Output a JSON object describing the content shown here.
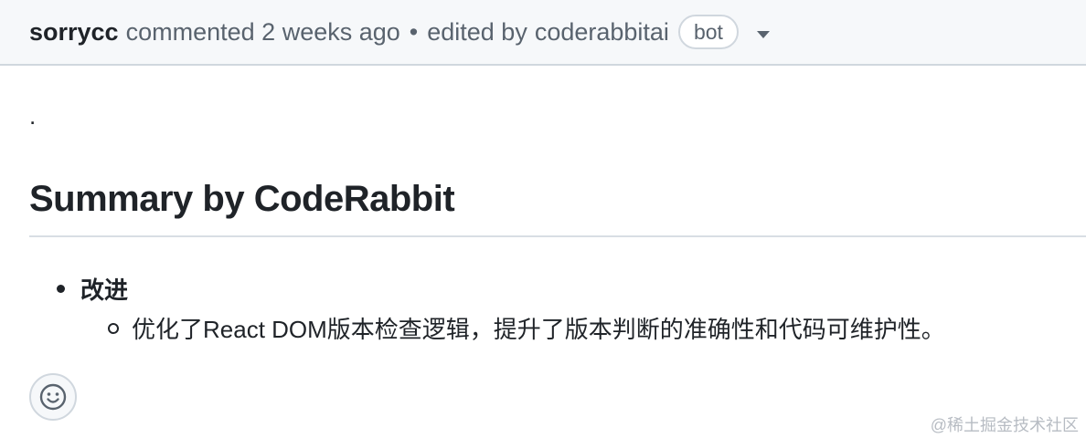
{
  "comment": {
    "author": "sorrycc",
    "action": "commented",
    "time": "2 weeks ago",
    "separator": "•",
    "edited_by_label": "edited by",
    "editor": "coderabbitai",
    "badge": "bot"
  },
  "body": {
    "dot": ".",
    "heading": "Summary by CodeRabbit",
    "list": [
      {
        "label": "改进",
        "children": [
          "优化了React DOM版本检查逻辑，提升了版本判断的准确性和代码可维护性。"
        ]
      }
    ]
  },
  "reaction_icon": "smiley-icon",
  "watermark": "@稀土掘金技术社区",
  "colors": {
    "header_bg": "#f6f8fa",
    "border": "#d0d7de",
    "text": "#1f2328",
    "muted": "#59636e"
  }
}
